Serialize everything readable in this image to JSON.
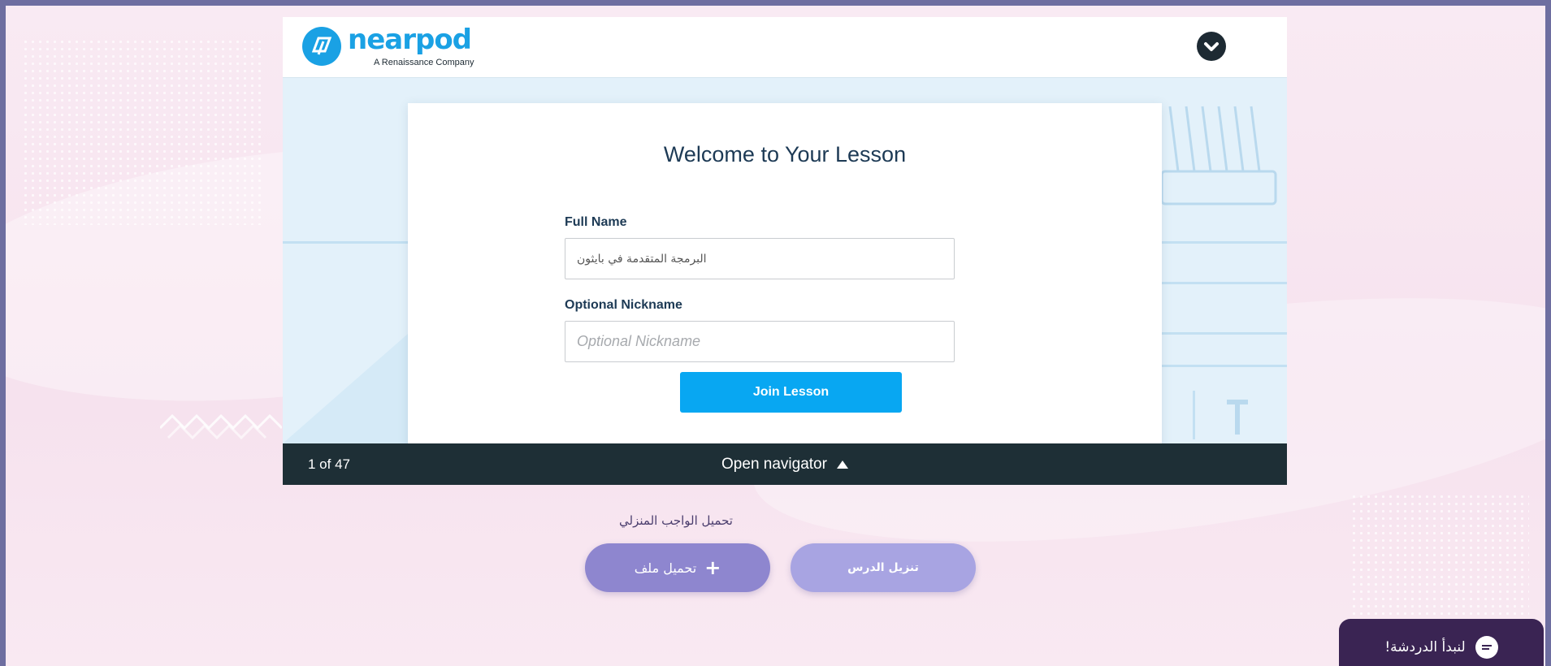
{
  "colors": {
    "page_border": "#6e6ea0",
    "brand_blue": "#1aa1e4",
    "join_button": "#08a7f2",
    "navigator_bar": "#1e2f36",
    "upload_button": "#8e86cf",
    "download_button": "#a8a4e2",
    "chat_button": "#3a2453",
    "heading_text": "#1d3a55"
  },
  "header": {
    "logo_name": "nearpod",
    "logo_tagline": "A Renaissance Company",
    "logo_icon": "nearpod-logo-icon",
    "collapse_icon": "chevron-down-icon"
  },
  "card": {
    "title": "Welcome to Your Lesson",
    "full_name": {
      "label": "Full Name",
      "value": "البرمجة المتقدمة في بايثون"
    },
    "nickname": {
      "label": "Optional Nickname",
      "placeholder": "Optional Nickname",
      "value": ""
    },
    "join_button": "Join Lesson"
  },
  "navigator": {
    "slide_position": "1 of 47",
    "open_label": "Open navigator",
    "arrow_icon": "triangle-up-icon"
  },
  "homework": {
    "label": "تحميل الواجب المنزلي",
    "upload_button": "تحميل ملف",
    "upload_icon": "plus-icon",
    "download_button": "تنزيل الدرس"
  },
  "chat": {
    "label": "لنبدأ الدردشة!",
    "icon": "chat-bubble-icon"
  }
}
